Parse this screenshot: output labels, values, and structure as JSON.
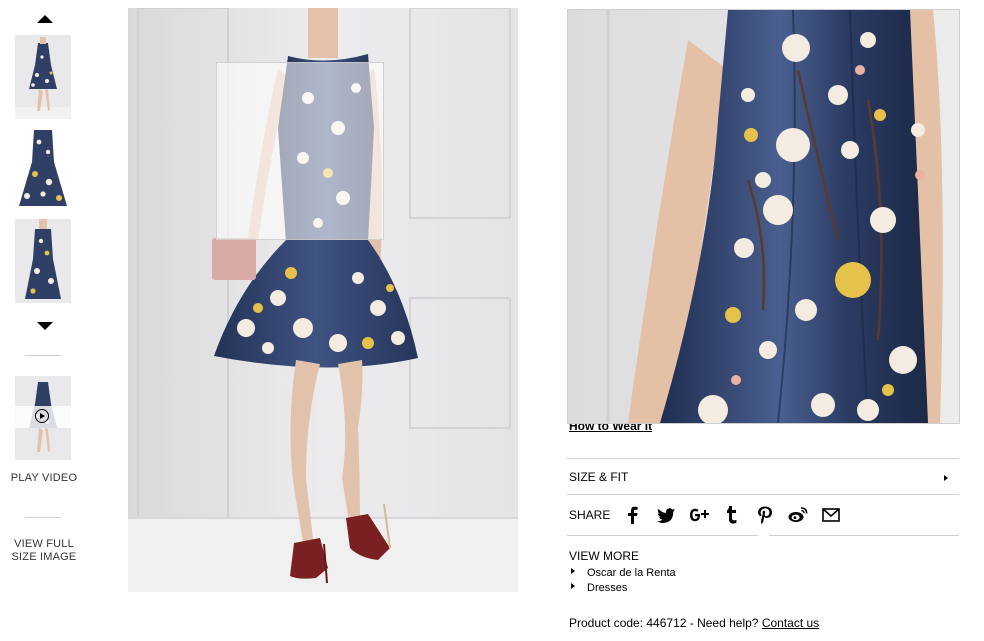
{
  "left_rail": {
    "scroll_up_icon": "triangle-up",
    "scroll_down_icon": "triangle-down",
    "thumbnails": [
      "full-length front view",
      "dress flat front",
      "dress on mannequin"
    ],
    "video_icon": "play-circle",
    "play_video_label": "PLAY VIDEO",
    "view_full_line1": "VIEW FULL",
    "view_full_line2": "SIZE IMAGE"
  },
  "product_info": {
    "how_to_wear_link": "How to Wear it",
    "size_fit_label": "SIZE & FIT",
    "share_label": "SHARE",
    "share_icons": [
      "facebook-icon",
      "twitter-icon",
      "google-plus-icon",
      "tumblr-icon",
      "pinterest-icon",
      "weibo-icon",
      "email-icon"
    ],
    "view_more_label": "VIEW MORE",
    "view_more_links": [
      "Oscar de la Renta",
      "Dresses"
    ],
    "product_code_text": "Product code: 446712 - Need help?",
    "contact_link": "Contact us"
  },
  "colors": {
    "dress_navy": "#2f3f66",
    "blossom": "#f4ece0",
    "blossom_yellow": "#e6c24a",
    "background_wall": "#e9e9eb",
    "divider": "#cfcfcf"
  }
}
